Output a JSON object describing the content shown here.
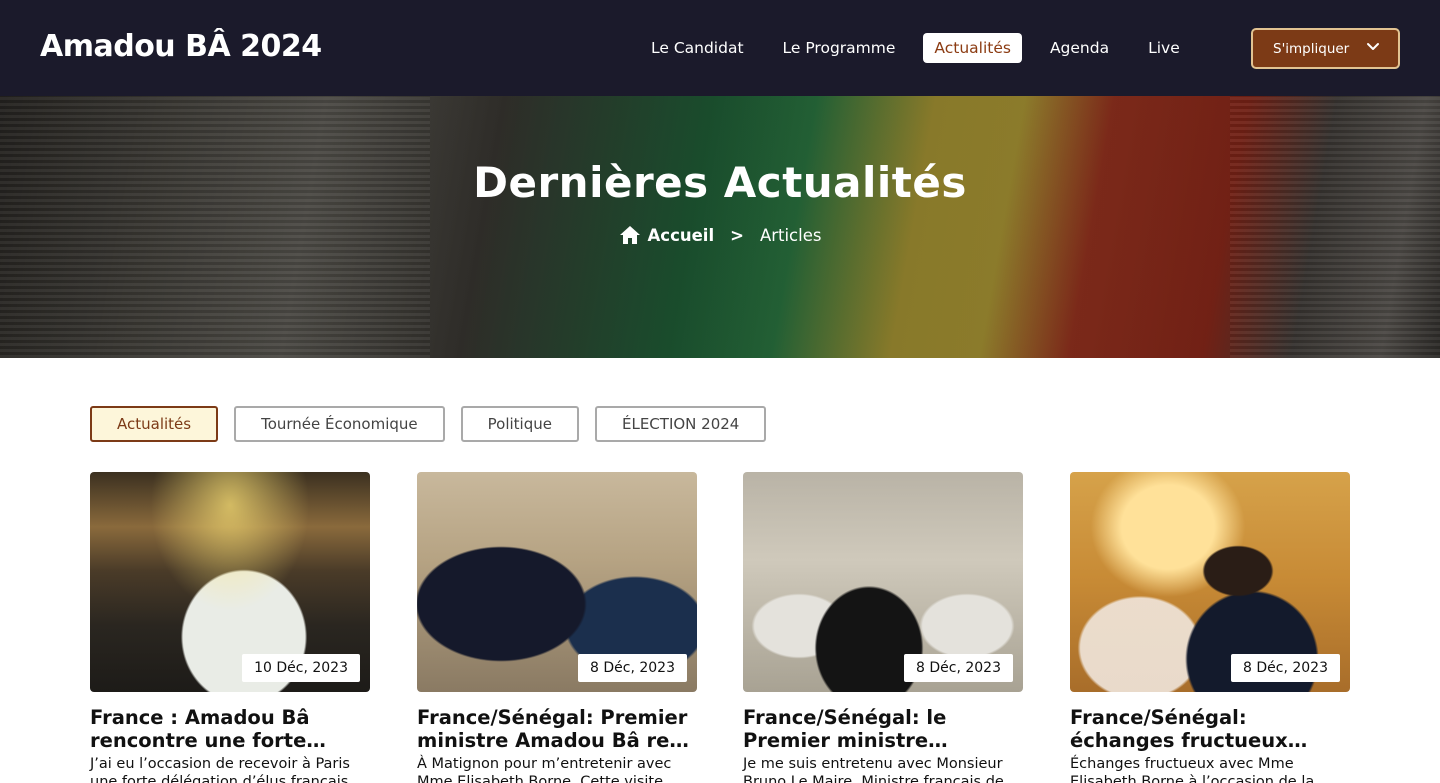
{
  "header": {
    "brand": "Amadou BÂ 2024",
    "nav": [
      {
        "label": "Le Candidat",
        "active": false
      },
      {
        "label": "Le Programme",
        "active": false
      },
      {
        "label": "Actualités",
        "active": true
      },
      {
        "label": "Agenda",
        "active": false
      },
      {
        "label": "Live",
        "active": false
      }
    ],
    "cta_label": "S'impliquer",
    "cta_icon": "chevron-down-icon"
  },
  "hero": {
    "title": "Dernières Actualités",
    "breadcrumb": {
      "home_icon": "home-icon",
      "home_label": "Accueil",
      "separator": ">",
      "current": "Articles"
    }
  },
  "filters": [
    {
      "label": "Actualités",
      "active": true
    },
    {
      "label": "Tournée Économique",
      "active": false
    },
    {
      "label": "Politique",
      "active": false
    },
    {
      "label": "ÉLECTION 2024",
      "active": false
    }
  ],
  "articles": [
    {
      "date": "10 Déc, 2023",
      "title": "France : Amadou Bâ rencontre une forte délégation d’élus français",
      "excerpt": "J’ai eu l’occasion de recevoir à Paris une forte délégation d’élus français"
    },
    {
      "date": "8 Déc, 2023",
      "title": "France/Sénégal: Premier ministre Amadou Bâ reçu à Matignon",
      "excerpt": "À Matignon pour m’entretenir avec Mme Elisabeth Borne. Cette visite"
    },
    {
      "date": "8 Déc, 2023",
      "title": "France/Sénégal: le Premier ministre Amadou Bâ reçu par Bruno Le Maire",
      "excerpt": "Je me suis entretenu avec Monsieur Bruno Le Maire, Ministre français de"
    },
    {
      "date": "8 Déc, 2023",
      "title": "France/Sénégal: échanges fructueux entre Amadou Bâ et Elisabeth Borne",
      "excerpt": "Échanges fructueux avec Mme Elisabeth Borne à l’occasion de la"
    }
  ],
  "colors": {
    "nav_bg": "#1b1a2b",
    "accent_brown": "#7c3a16",
    "active_link_text": "#8b3b12",
    "active_filter_bg": "#fdf6da"
  }
}
